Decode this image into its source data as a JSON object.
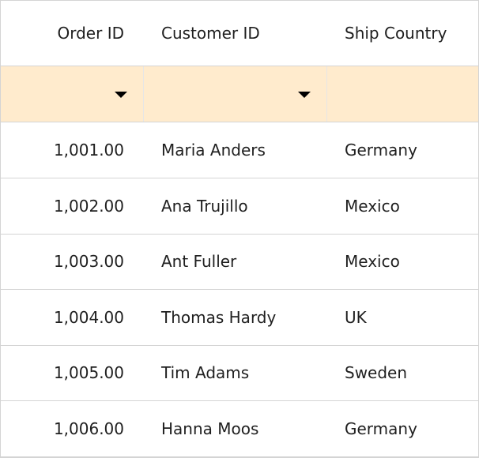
{
  "columns": {
    "order_id": "Order ID",
    "customer_id": "Customer ID",
    "ship_country": "Ship Country"
  },
  "filter_row": {
    "order_id_icon": "dropdown-arrow-icon",
    "customer_id_icon": "dropdown-arrow-icon"
  },
  "rows": [
    {
      "order_id": "1,001.00",
      "customer_id": "Maria Anders",
      "ship_country": "Germany"
    },
    {
      "order_id": "1,002.00",
      "customer_id": "Ana Trujillo",
      "ship_country": "Mexico"
    },
    {
      "order_id": "1,003.00",
      "customer_id": "Ant Fuller",
      "ship_country": "Mexico"
    },
    {
      "order_id": "1,004.00",
      "customer_id": "Thomas Hardy",
      "ship_country": "UK"
    },
    {
      "order_id": "1,005.00",
      "customer_id": "Tim Adams",
      "ship_country": "Sweden"
    },
    {
      "order_id": "1,006.00",
      "customer_id": "Hanna Moos",
      "ship_country": "Germany"
    }
  ],
  "colors": {
    "filter_row_background": "#ffebcd",
    "grid_line": "#d4d4d4",
    "text": "#1f1f1f"
  }
}
